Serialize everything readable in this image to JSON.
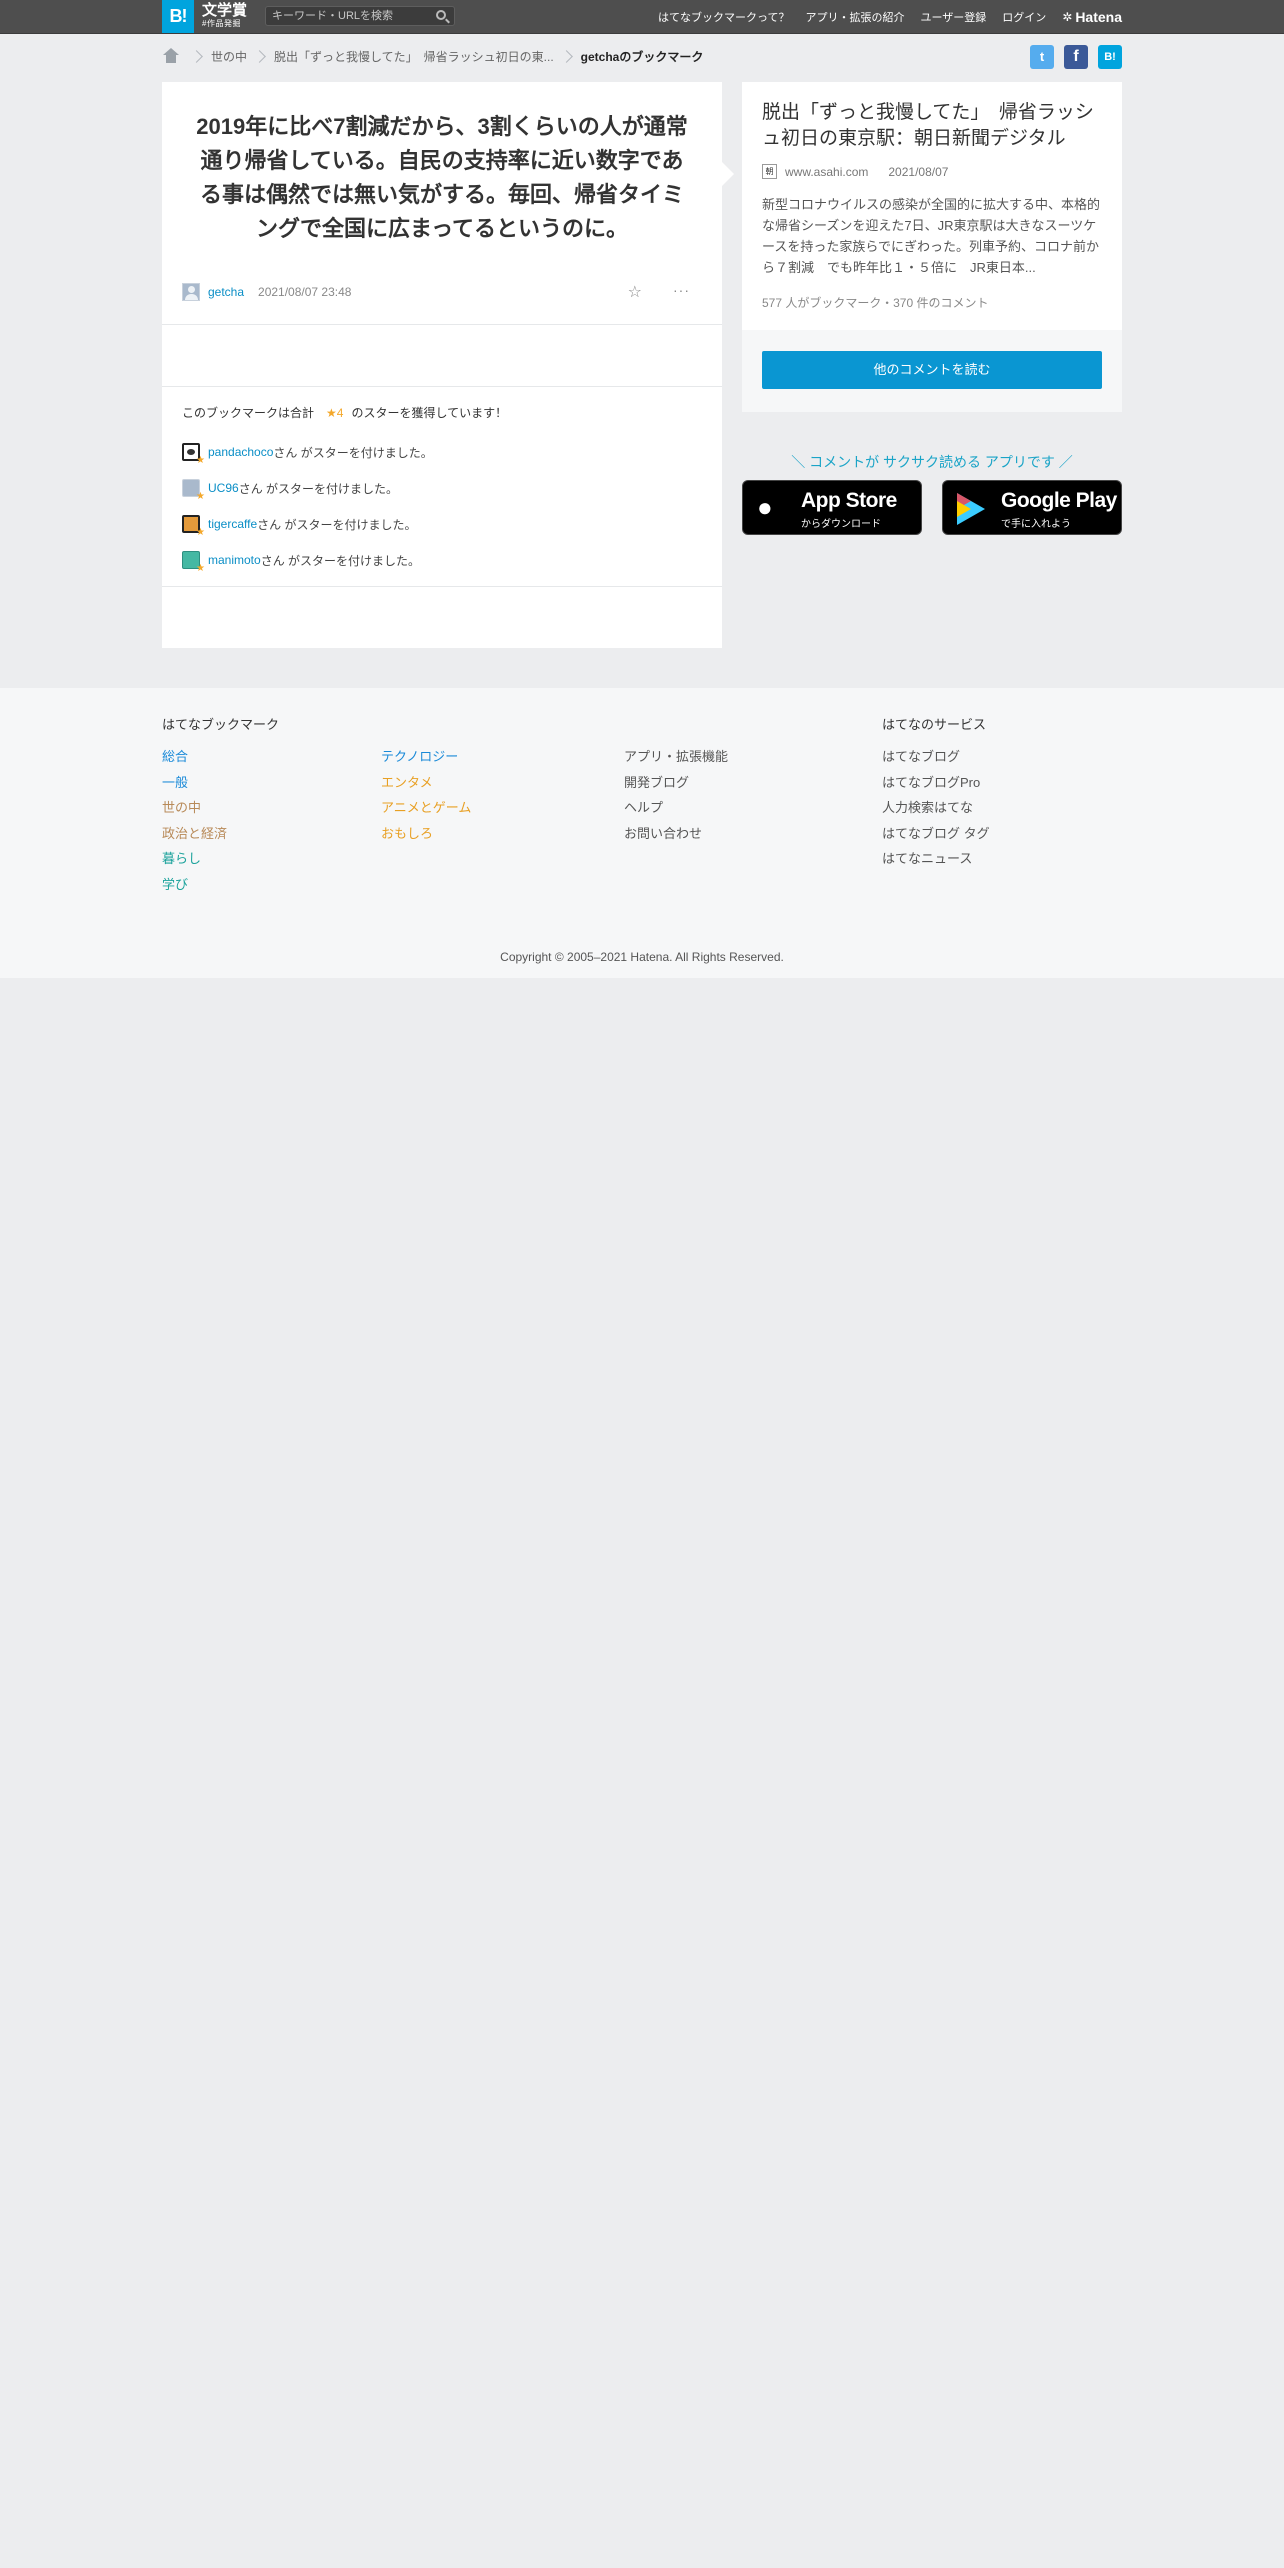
{
  "header": {
    "logo_b": "B!",
    "award_big": "文学賞",
    "award_small": "#作品発掘",
    "search_placeholder": "キーワード・URLを検索",
    "nav": [
      "はてなブックマークって？",
      "アプリ・拡張の紹介",
      "ユーザー登録",
      "ログイン"
    ],
    "hatena_logo": "Hatena"
  },
  "breadcrumb": {
    "items": [
      "世の中",
      "脱出「ずっと我慢してた」　帰省ラッシュ初日の東...",
      "getchaのブックマーク"
    ]
  },
  "share": {
    "twitter": "t",
    "facebook": "f",
    "hatena": "B!"
  },
  "bookmark": {
    "comment": "2019年に比べ7割減だから、3割くらいの人が通常通り帰省している。自民の支持率に近い数字である事は偶然では無い気がする。毎回、帰省タイミングで全国に広まってるというのに。",
    "user": "getcha",
    "date": "2021/08/07 23:48",
    "stars_prefix": "このブックマークは合計",
    "stars_count": "★4",
    "stars_suffix": "のスターを獲得しています！",
    "star_users": [
      {
        "name": "pandachoco",
        "text": "さん がスターを付けました。"
      },
      {
        "name": "UC96",
        "text": "さん がスターを付けました。"
      },
      {
        "name": "tigercaffe",
        "text": "さん がスターを付けました。"
      },
      {
        "name": "manimoto",
        "text": "さん がスターを付けました。"
      }
    ]
  },
  "entry": {
    "title": "脱出「ずっと我慢してた」　帰省ラッシュ初日の東京駅：朝日新聞デジタル",
    "favicon_text": "朝",
    "domain": "www.asahi.com",
    "date": "2021/08/07",
    "summary": "新型コロナウイルスの感染が全国的に拡大する中、本格的な帰省シーズンを迎えた7日、JR東京駅は大きなスーツケースを持った家族らでにぎわった。列車予約、コロナ前から７割減　でも昨年比１・５倍に　JR東日本...",
    "stats": "577 人がブックマーク・370 件のコメント",
    "read_more": "他のコメントを読む"
  },
  "app_promo": {
    "text": "＼ コメントが サクサク読める アプリです ／",
    "appstore_big": "App Store",
    "appstore_small": "からダウンロード",
    "googleplay_big": "Google Play",
    "googleplay_small": "で手に入れよう"
  },
  "footer": {
    "heading_left": "はてなブックマーク",
    "heading_right": "はてなのサービス",
    "col1": [
      "総合",
      "一般",
      "世の中",
      "政治と経済",
      "暮らし",
      "学び"
    ],
    "col2": [
      "テクノロジー",
      "エンタメ",
      "アニメとゲーム",
      "おもしろ"
    ],
    "col3": [
      "アプリ・拡張機能",
      "開発ブログ",
      "ヘルプ",
      "お問い合わせ"
    ],
    "col4": [
      "はてなブログ",
      "はてなブログPro",
      "人力検索はてな",
      "はてなブログ タグ",
      "はてなニュース"
    ],
    "copyright": "Copyright © 2005–2021 Hatena. All Rights Reserved."
  },
  "colors": {
    "header_bg": "#4e4e4e",
    "brand_blue": "#00a4de",
    "link_blue": "#0a8ec6",
    "button_blue": "#0a96d2",
    "star_yellow": "#f4a82b",
    "page_bg": "#ecedef"
  }
}
